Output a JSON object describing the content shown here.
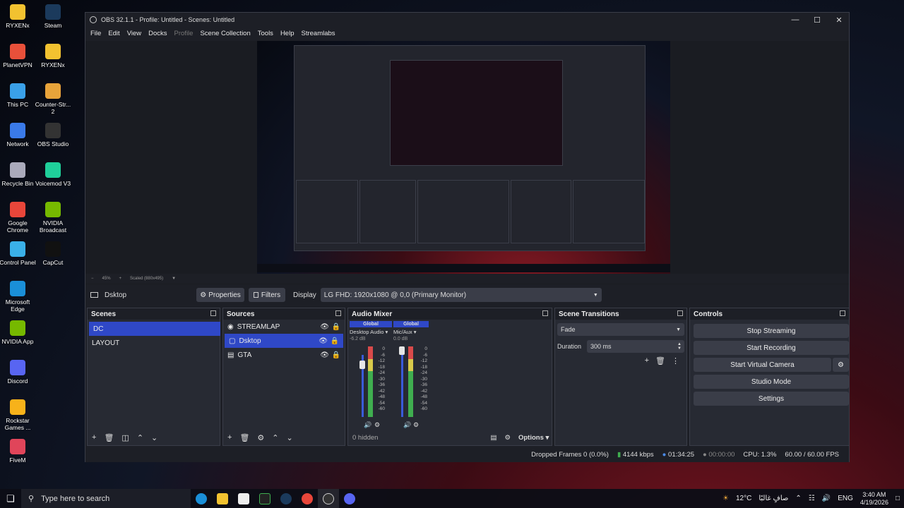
{
  "desktop_icons": [
    {
      "label": "RYXENx",
      "color": "#f2c230"
    },
    {
      "label": "Steam",
      "color": "#1b3a5c"
    },
    {
      "label": "PlanetVPN",
      "color": "#e8503a"
    },
    {
      "label": "RYXENx",
      "color": "#f2c230"
    },
    {
      "label": "This PC",
      "color": "#3aa0e8"
    },
    {
      "label": "Counter-Str... 2",
      "color": "#e8a33a"
    },
    {
      "label": "Network",
      "color": "#3a7ae8"
    },
    {
      "label": "OBS Studio",
      "color": "#333"
    },
    {
      "label": "Recycle Bin",
      "color": "#aab"
    },
    {
      "label": "Voicemod V3",
      "color": "#1fcf9a"
    },
    {
      "label": "Google Chrome",
      "color": "#e8463a"
    },
    {
      "label": "NVIDIA Broadcast",
      "color": "#76b900"
    },
    {
      "label": "Control Panel",
      "color": "#3ab0e8"
    },
    {
      "label": "CapCut",
      "color": "#111"
    },
    {
      "label": "Microsoft Edge",
      "color": "#1a8fd8"
    },
    {
      "label": "NVIDIA App",
      "color": "#76b900"
    },
    {
      "label": "Discord",
      "color": "#5865f2"
    },
    {
      "label": "Rockstar Games ...",
      "color": "#f7b21a"
    },
    {
      "label": "FiveM",
      "color": "#e0455a"
    }
  ],
  "window": {
    "title": "OBS 32.1.1 - Profile: Untitled - Scenes: Untitled"
  },
  "menu": [
    "File",
    "Edit",
    "View",
    "Docks",
    "Profile",
    "Scene Collection",
    "Tools",
    "Help",
    "Streamlabs"
  ],
  "preview_bar": {
    "zoom": "45%",
    "scale": "Scaled (880x495)"
  },
  "source_toolbar": {
    "source_name": "Dsktop",
    "properties": "Properties",
    "filters": "Filters",
    "display_label": "Display",
    "display_value": "LG FHD: 1920x1080 @ 0,0 (Primary Monitor)"
  },
  "scenes": {
    "title": "Scenes",
    "items": [
      "DC",
      "LAYOUT"
    ]
  },
  "sources": {
    "title": "Sources",
    "items": [
      "STREAMLAP",
      "Dsktop",
      "GTA"
    ]
  },
  "mixer": {
    "title": "Audio Mixer",
    "channels": [
      {
        "global": "Global",
        "name": "Desktop Audio",
        "db": "-6.2 dB",
        "level": 0.75
      },
      {
        "global": "Global",
        "name": "Mic/Aux",
        "db": "0.0 dB",
        "level": 0.62
      }
    ],
    "scale": [
      "0",
      "-6",
      "-12",
      "-18",
      "-24",
      "-30",
      "-36",
      "-42",
      "-48",
      "-54",
      "-60"
    ],
    "hidden": "0 hidden",
    "options": "Options"
  },
  "transitions": {
    "title": "Scene Transitions",
    "selected": "Fade",
    "duration_label": "Duration",
    "duration": "300 ms"
  },
  "controls": {
    "title": "Controls",
    "buttons": [
      "Stop Streaming",
      "Start Recording",
      "Start Virtual Camera",
      "Studio Mode",
      "Settings"
    ]
  },
  "status": {
    "dropped": "Dropped Frames 0 (0.0%)",
    "kbps": "4144 kbps",
    "stream_time": "01:34:25",
    "rec_time": "00:00:00",
    "cpu": "CPU: 1.3%",
    "fps": "60.00 / 60.00 FPS"
  },
  "taskbar": {
    "search": "Type here to search",
    "weather": "12°C",
    "weather_desc": "صافٍ غالبًا",
    "lang": "ENG",
    "time": "3:40 AM",
    "date": "4/19/2026"
  }
}
